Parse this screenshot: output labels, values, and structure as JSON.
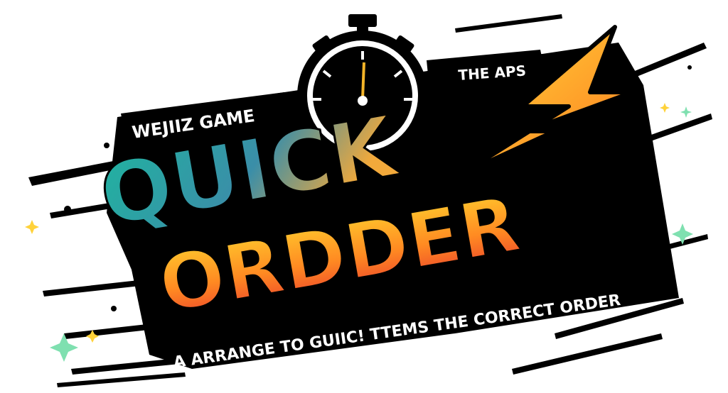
{
  "logo": {
    "top_left_text": "WEJIIZ GAME",
    "top_right_text": "THE APS",
    "title_line1": "QUICK",
    "title_line2": "ORDDER",
    "tagline": "A ARRANGE TO GUIIC! TTEMS THE CORRECT ORDER",
    "colors": {
      "banner": "#000000",
      "quick_gradient": [
        "#1fb5a0",
        "#3a8ea8",
        "#f2a93b"
      ],
      "order_gradient": [
        "#ffd12e",
        "#ff8a22",
        "#e93b2c"
      ],
      "bolt": [
        "#ffd93a",
        "#ff7a1f"
      ],
      "sparkle_green": "#7fe0b0",
      "sparkle_yellow": "#ffd23a"
    },
    "icons": [
      "stopwatch-icon",
      "lightning-bolt-icon",
      "sparkle-icon"
    ]
  }
}
